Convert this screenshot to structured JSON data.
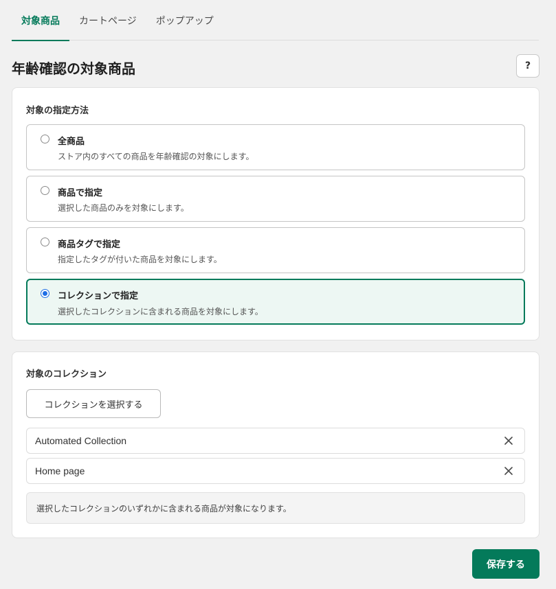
{
  "tabs": [
    {
      "label": "対象商品",
      "active": true
    },
    {
      "label": "カートページ",
      "active": false
    },
    {
      "label": "ポップアップ",
      "active": false
    }
  ],
  "page": {
    "title": "年齢確認の対象商品",
    "help_label": "?"
  },
  "target_method": {
    "title": "対象の指定方法",
    "options": [
      {
        "label": "全商品",
        "description": "ストア内のすべての商品を年齢確認の対象にします。",
        "selected": false
      },
      {
        "label": "商品で指定",
        "description": "選択した商品のみを対象にします。",
        "selected": false
      },
      {
        "label": "商品タグで指定",
        "description": "指定したタグが付いた商品を対象にします。",
        "selected": false
      },
      {
        "label": "コレクションで指定",
        "description": "選択したコレクションに含まれる商品を対象にします。",
        "selected": true
      }
    ]
  },
  "collections": {
    "title": "対象のコレクション",
    "select_button": "コレクションを選択する",
    "items": [
      {
        "name": "Automated Collection",
        "remove_icon": "close-icon"
      },
      {
        "name": "Home page",
        "remove_icon": "close-icon"
      }
    ],
    "info": "選択したコレクションのいずれかに含まれる商品が対象になります。"
  },
  "save_button": "保存する",
  "colors": {
    "accent": "#047a5a",
    "selected_bg": "#edf7f3",
    "radio_selected": "#1f6fe5",
    "page_bg": "#f1f1f1"
  }
}
